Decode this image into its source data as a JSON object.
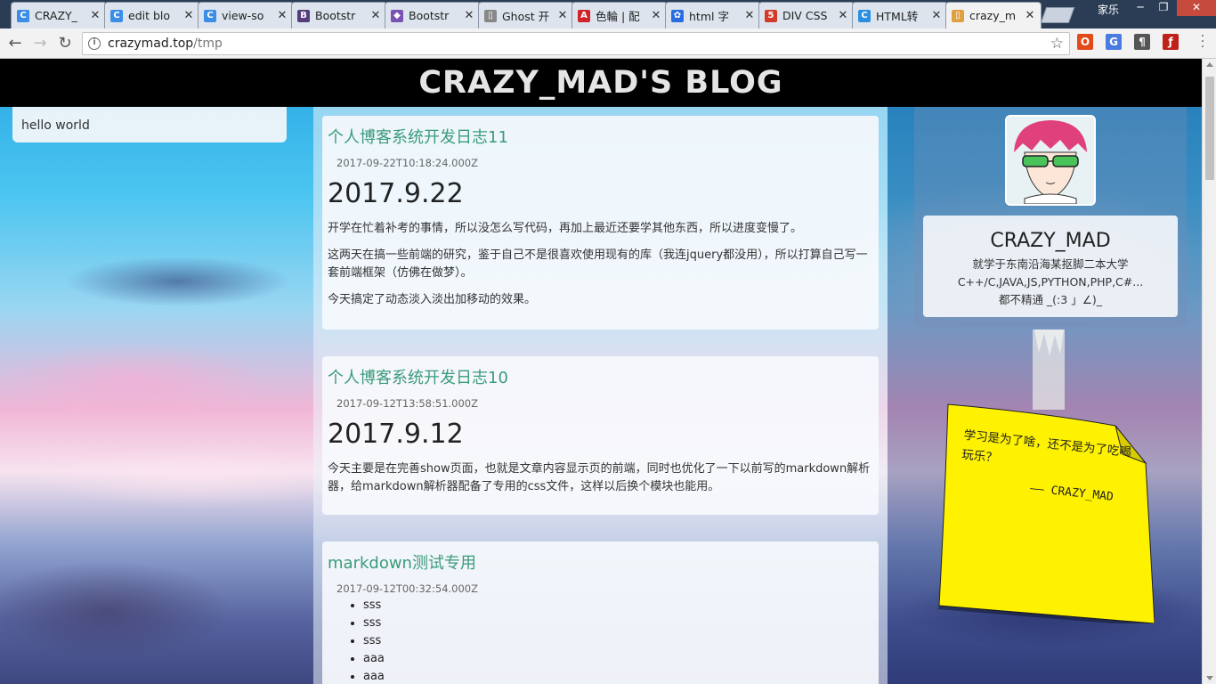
{
  "browser": {
    "tabs": [
      {
        "title": "CRAZY_",
        "favicon": "crazy-c-icon",
        "favicon_color": "#3a8ee6"
      },
      {
        "title": "edit blo",
        "favicon": "crazy-c-icon",
        "favicon_color": "#3a8ee6"
      },
      {
        "title": "view-so",
        "favicon": "crazy-c-icon",
        "favicon_color": "#3a8ee6"
      },
      {
        "title": "Bootstr",
        "favicon": "bootstrap-icon",
        "favicon_color": "#563d7c"
      },
      {
        "title": "Bootstr",
        "favicon": "bootstrap-hex-icon",
        "favicon_color": "#7952b3"
      },
      {
        "title": "Ghost 开",
        "favicon": "page-icon",
        "favicon_color": "#888888"
      },
      {
        "title": "色輪 | 配",
        "favicon": "adobe-icon",
        "favicon_color": "#d2232a"
      },
      {
        "title": "html 字",
        "favicon": "baidu-paw-icon",
        "favicon_color": "#2a6de0"
      },
      {
        "title": "DIV CSS",
        "favicon": "five-icon",
        "favicon_color": "#d23b2a"
      },
      {
        "title": "HTML转",
        "favicon": "chrome-c-icon",
        "favicon_color": "#2a8fe0"
      },
      {
        "title": "crazy_m",
        "favicon": "page-icon",
        "favicon_color": "#e0a040",
        "active": true
      }
    ],
    "user_label": "家乐",
    "address": {
      "host": "crazymad.top",
      "path": "/tmp"
    },
    "extensions": [
      {
        "name": "office-icon",
        "color": "#e24a1a",
        "glyph": "O"
      },
      {
        "name": "translate-icon",
        "color": "#4a7be0",
        "glyph": "G"
      },
      {
        "name": "paragraph-icon",
        "color": "#555555",
        "glyph": "¶"
      },
      {
        "name": "flash-icon",
        "color": "#c0201a",
        "glyph": "ƒ"
      }
    ]
  },
  "site": {
    "banner_title": "CRAZY_MAD'S BLOG",
    "left_card_text": "hello world"
  },
  "posts": [
    {
      "title": "个人博客系统开发日志11",
      "date": "2017-09-22T10:18:24.000Z",
      "heading": "2017.9.22",
      "paragraphs": [
        "开学在忙着补考的事情，所以没怎么写代码，再加上最近还要学其他东西，所以进度变慢了。",
        "这两天在搞一些前端的研究，鉴于自己不是很喜欢使用现有的库（我连jquery都没用），所以打算自己写一套前端框架（仿佛在做梦）。",
        "今天搞定了动态淡入淡出加移动的效果。"
      ]
    },
    {
      "title": "个人博客系统开发日志10",
      "date": "2017-09-12T13:58:51.000Z",
      "heading": "2017.9.12",
      "paragraphs": [
        "今天主要是在完善show页面，也就是文章内容显示页的前端，同时也优化了一下以前写的markdown解析器，给markdown解析器配备了专用的css文件，这样以后换个模块也能用。"
      ]
    },
    {
      "title": "markdown测试专用",
      "date": "2017-09-12T00:32:54.000Z",
      "list": [
        "sss",
        "sss",
        "sss",
        "aaa",
        "aaa"
      ]
    }
  ],
  "profile": {
    "name": "CRAZY_MAD",
    "lines": [
      "就学于东南沿海某抠脚二本大学",
      "C++/C,JAVA,JS,PYTHON,PHP,C#...",
      "都不精通 _(:3 」∠)_"
    ]
  },
  "note": {
    "text": "学习是为了啥，还不是为了吃喝玩乐？",
    "signature": "—— CRAZY_MAD",
    "color": "#fff200"
  }
}
